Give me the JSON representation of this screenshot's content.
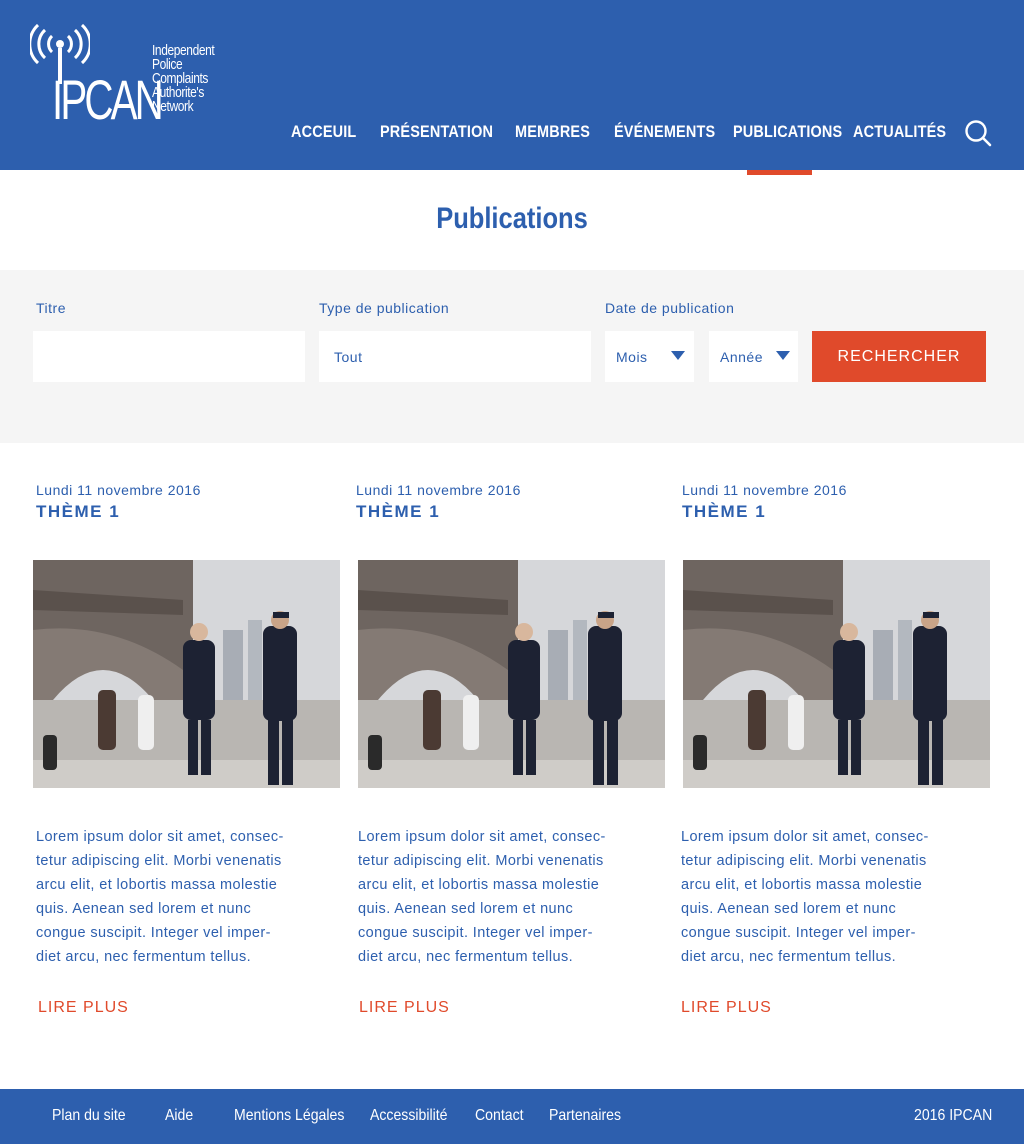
{
  "colors": {
    "primary": "#2d5fae",
    "accent": "#e04a2b",
    "band": "#f5f5f5"
  },
  "logo": {
    "acronym": "IPCAN",
    "lines": [
      "Independent",
      "Police",
      "Complaints",
      "Authorite's",
      "Network"
    ],
    "icon": "broadcast-antenna-icon"
  },
  "nav": {
    "items": [
      "ACCEUIL",
      "PRÉSENTATION",
      "MEMBRES",
      "ÉVÉNEMENTS",
      "PUBLICATIONS",
      "ACTUALITÉS"
    ],
    "active": "PUBLICATIONS",
    "search_icon": "search-icon"
  },
  "page": {
    "title": "Publications"
  },
  "filters": {
    "title_label": "Titre",
    "title_value": "",
    "type_label": "Type de publication",
    "type_value": "Tout",
    "date_label": "Date de publication",
    "month_value": "Mois",
    "year_value": "Année",
    "search_button": "RECHERCHER"
  },
  "cards": [
    {
      "date": "Lundi 11 novembre 2016",
      "theme": "THÈME 1",
      "image": "police-eiffel-tower-photo",
      "text": [
        "Lorem ipsum dolor sit amet, consec-",
        "tetur adipiscing elit. Morbi venenatis",
        "arcu elit, et lobortis massa molestie",
        "quis. Aenean sed lorem et nunc",
        "congue suscipit. Integer vel imper-",
        "diet arcu, nec fermentum tellus."
      ],
      "more": "LIRE PLUS"
    },
    {
      "date": "Lundi 11 novembre 2016",
      "theme": "THÈME 1",
      "image": "police-eiffel-tower-photo",
      "text": [
        "Lorem ipsum dolor sit amet, consec-",
        "tetur adipiscing elit. Morbi venenatis",
        "arcu elit, et lobortis massa molestie",
        "quis. Aenean sed lorem et nunc",
        "congue suscipit. Integer vel imper-",
        "diet arcu, nec fermentum tellus."
      ],
      "more": "LIRE PLUS"
    },
    {
      "date": "Lundi 11 novembre 2016",
      "theme": "THÈME 1",
      "image": "police-eiffel-tower-photo",
      "text": [
        "Lorem ipsum dolor sit amet, consec-",
        "tetur adipiscing elit. Morbi venenatis",
        "arcu elit, et lobortis massa molestie",
        "quis. Aenean sed lorem et nunc",
        "congue suscipit. Integer vel imper-",
        "diet arcu, nec fermentum tellus."
      ],
      "more": "LIRE PLUS"
    }
  ],
  "footer": {
    "links": [
      "Plan du site",
      "Aide",
      "Mentions Légales",
      "Accessibilité",
      "Contact",
      "Partenaires"
    ],
    "copyright": "2016 IPCAN"
  }
}
